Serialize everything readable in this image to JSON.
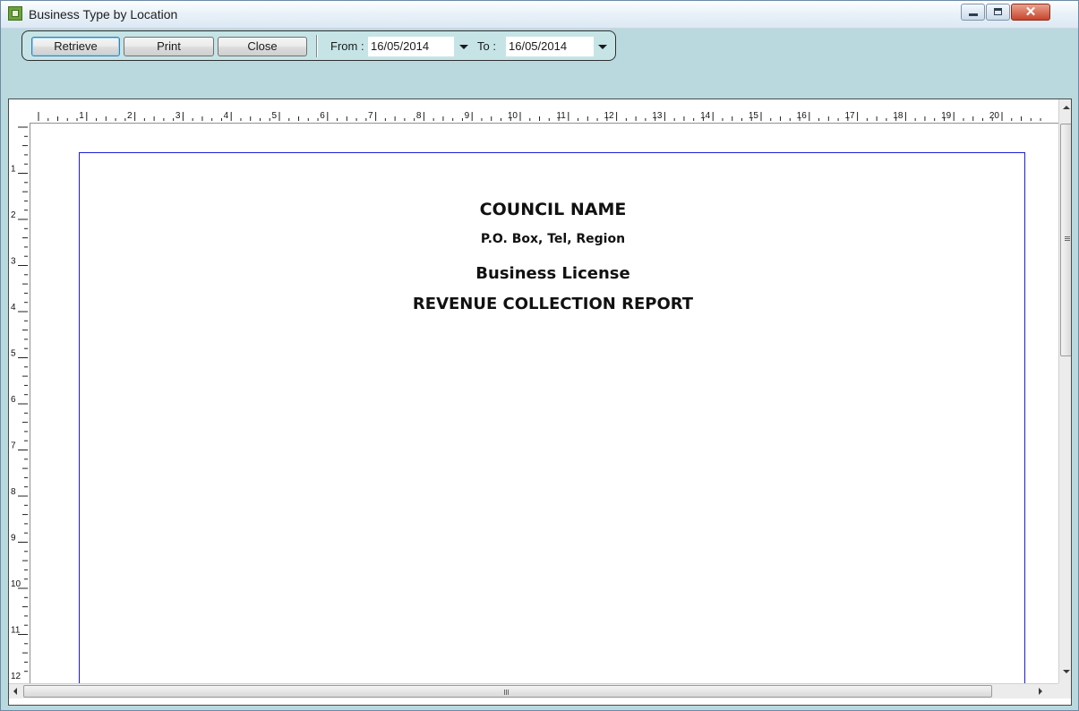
{
  "window": {
    "title": "Business Type by Location",
    "icon": "report-icon",
    "controls": [
      "minimize-icon",
      "maximize-icon",
      "close-icon"
    ],
    "close_glyph": "✕"
  },
  "toolbar": {
    "retrieve_label": "Retrieve",
    "print_label": "Print",
    "close_label": "Close",
    "from_label": "From :",
    "from_value": "16/05/2014",
    "to_label": "To :",
    "to_value": "16/05/2014"
  },
  "report": {
    "council_name": "COUNCIL NAME",
    "address_line": "P.O. Box, Tel, Region",
    "subtitle": "Business License",
    "report_title": "REVENUE COLLECTION REPORT"
  },
  "rulers": {
    "horizontal_numbers": [
      "1",
      "2",
      "3",
      "4",
      "5",
      "6",
      "7",
      "8",
      "9",
      "10",
      "11",
      "12",
      "13",
      "14",
      "15",
      "16",
      "17",
      "18",
      "19",
      "20"
    ],
    "vertical_numbers": [
      "1",
      "2",
      "3",
      "4",
      "5",
      "6",
      "7",
      "8",
      "9",
      "10",
      "11",
      "12"
    ]
  },
  "colors": {
    "window_background": "#b9d9de",
    "page_border": "#1c1cd6",
    "close_button": "#c8452c"
  }
}
